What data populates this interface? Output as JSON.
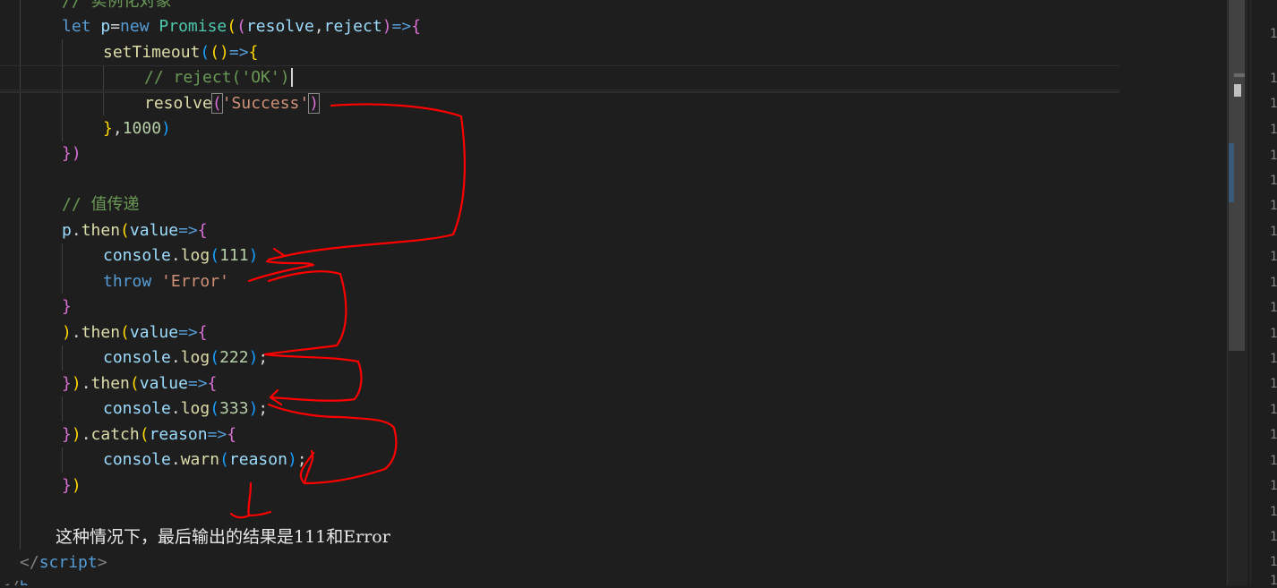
{
  "editor": {
    "comment_top": "// 实例化对象",
    "comment_value": "// 值传递",
    "literals": {
      "reject_arg": "'OK'",
      "resolve_arg": "'Success'",
      "timeout_ms": "1000",
      "log1": "111",
      "throw_arg": "'Error'",
      "log2": "222",
      "log3": "333"
    }
  },
  "note_text": "这种情况下，最后输出的结果是111和Error",
  "closing_tag": "script",
  "side_numbers": [
    "1",
    "1",
    "1",
    "1",
    "1",
    "1",
    "1",
    "1",
    "1",
    "1",
    "1",
    "1",
    "1",
    "1",
    "1",
    "1",
    "1",
    "1",
    "1",
    "1",
    "1",
    "1"
  ],
  "colors": {
    "background": "#1e1e1e",
    "keyword": "#569cd6",
    "function": "#dcdcaa",
    "string": "#ce9178",
    "number": "#b5cea8",
    "comment": "#6a9955",
    "annotation_pen": "#ff0000"
  }
}
